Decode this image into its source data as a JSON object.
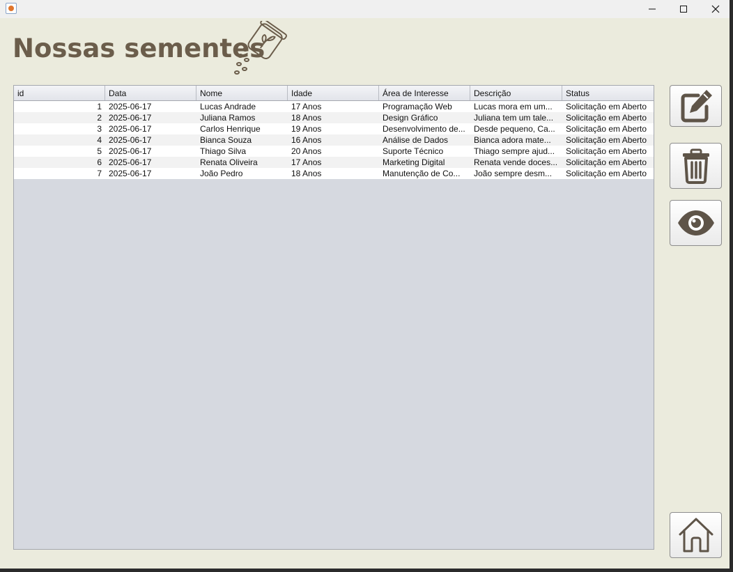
{
  "window": {
    "controls": {
      "minimize": "minimize-icon",
      "maximize": "maximize-icon",
      "close": "close-icon"
    }
  },
  "header": {
    "title": "Nossas sementes",
    "icon": "seed-jar-icon"
  },
  "table": {
    "columns": [
      "id",
      "Data",
      "Nome",
      "Idade",
      "Área de Interesse",
      "Descrição",
      "Status"
    ],
    "rows": [
      [
        "1",
        "2025-06-17",
        "Lucas Andrade",
        "17 Anos",
        "Programação Web",
        "Lucas mora em um...",
        "Solicitação em Aberto"
      ],
      [
        "2",
        "2025-06-17",
        "Juliana Ramos",
        "18 Anos",
        "Design Gráfico",
        "Juliana tem um tale...",
        "Solicitação em Aberto"
      ],
      [
        "3",
        "2025-06-17",
        "Carlos Henrique",
        "19 Anos",
        "Desenvolvimento de...",
        "Desde pequeno, Ca...",
        "Solicitação em Aberto"
      ],
      [
        "4",
        "2025-06-17",
        "Bianca Souza",
        "16 Anos",
        "Análise de Dados",
        "Bianca adora mate...",
        "Solicitação em Aberto"
      ],
      [
        "5",
        "2025-06-17",
        "Thiago Silva",
        "20 Anos",
        "Suporte Técnico",
        "Thiago sempre ajud...",
        "Solicitação em Aberto"
      ],
      [
        "6",
        "2025-06-17",
        "Renata Oliveira",
        "17 Anos",
        "Marketing Digital",
        "Renata vende doces...",
        "Solicitação em Aberto"
      ],
      [
        "7",
        "2025-06-17",
        "João Pedro",
        "18 Anos",
        "Manutenção de Co...",
        "João sempre desm...",
        "Solicitação em Aberto"
      ]
    ]
  },
  "actions": {
    "edit": "edit-icon",
    "delete": "trash-icon",
    "view": "eye-icon",
    "home": "home-icon"
  },
  "colors": {
    "background": "#ebebdd",
    "title": "#6b5d4b",
    "icon": "#5e5448",
    "table_empty": "#d6d9e0"
  }
}
